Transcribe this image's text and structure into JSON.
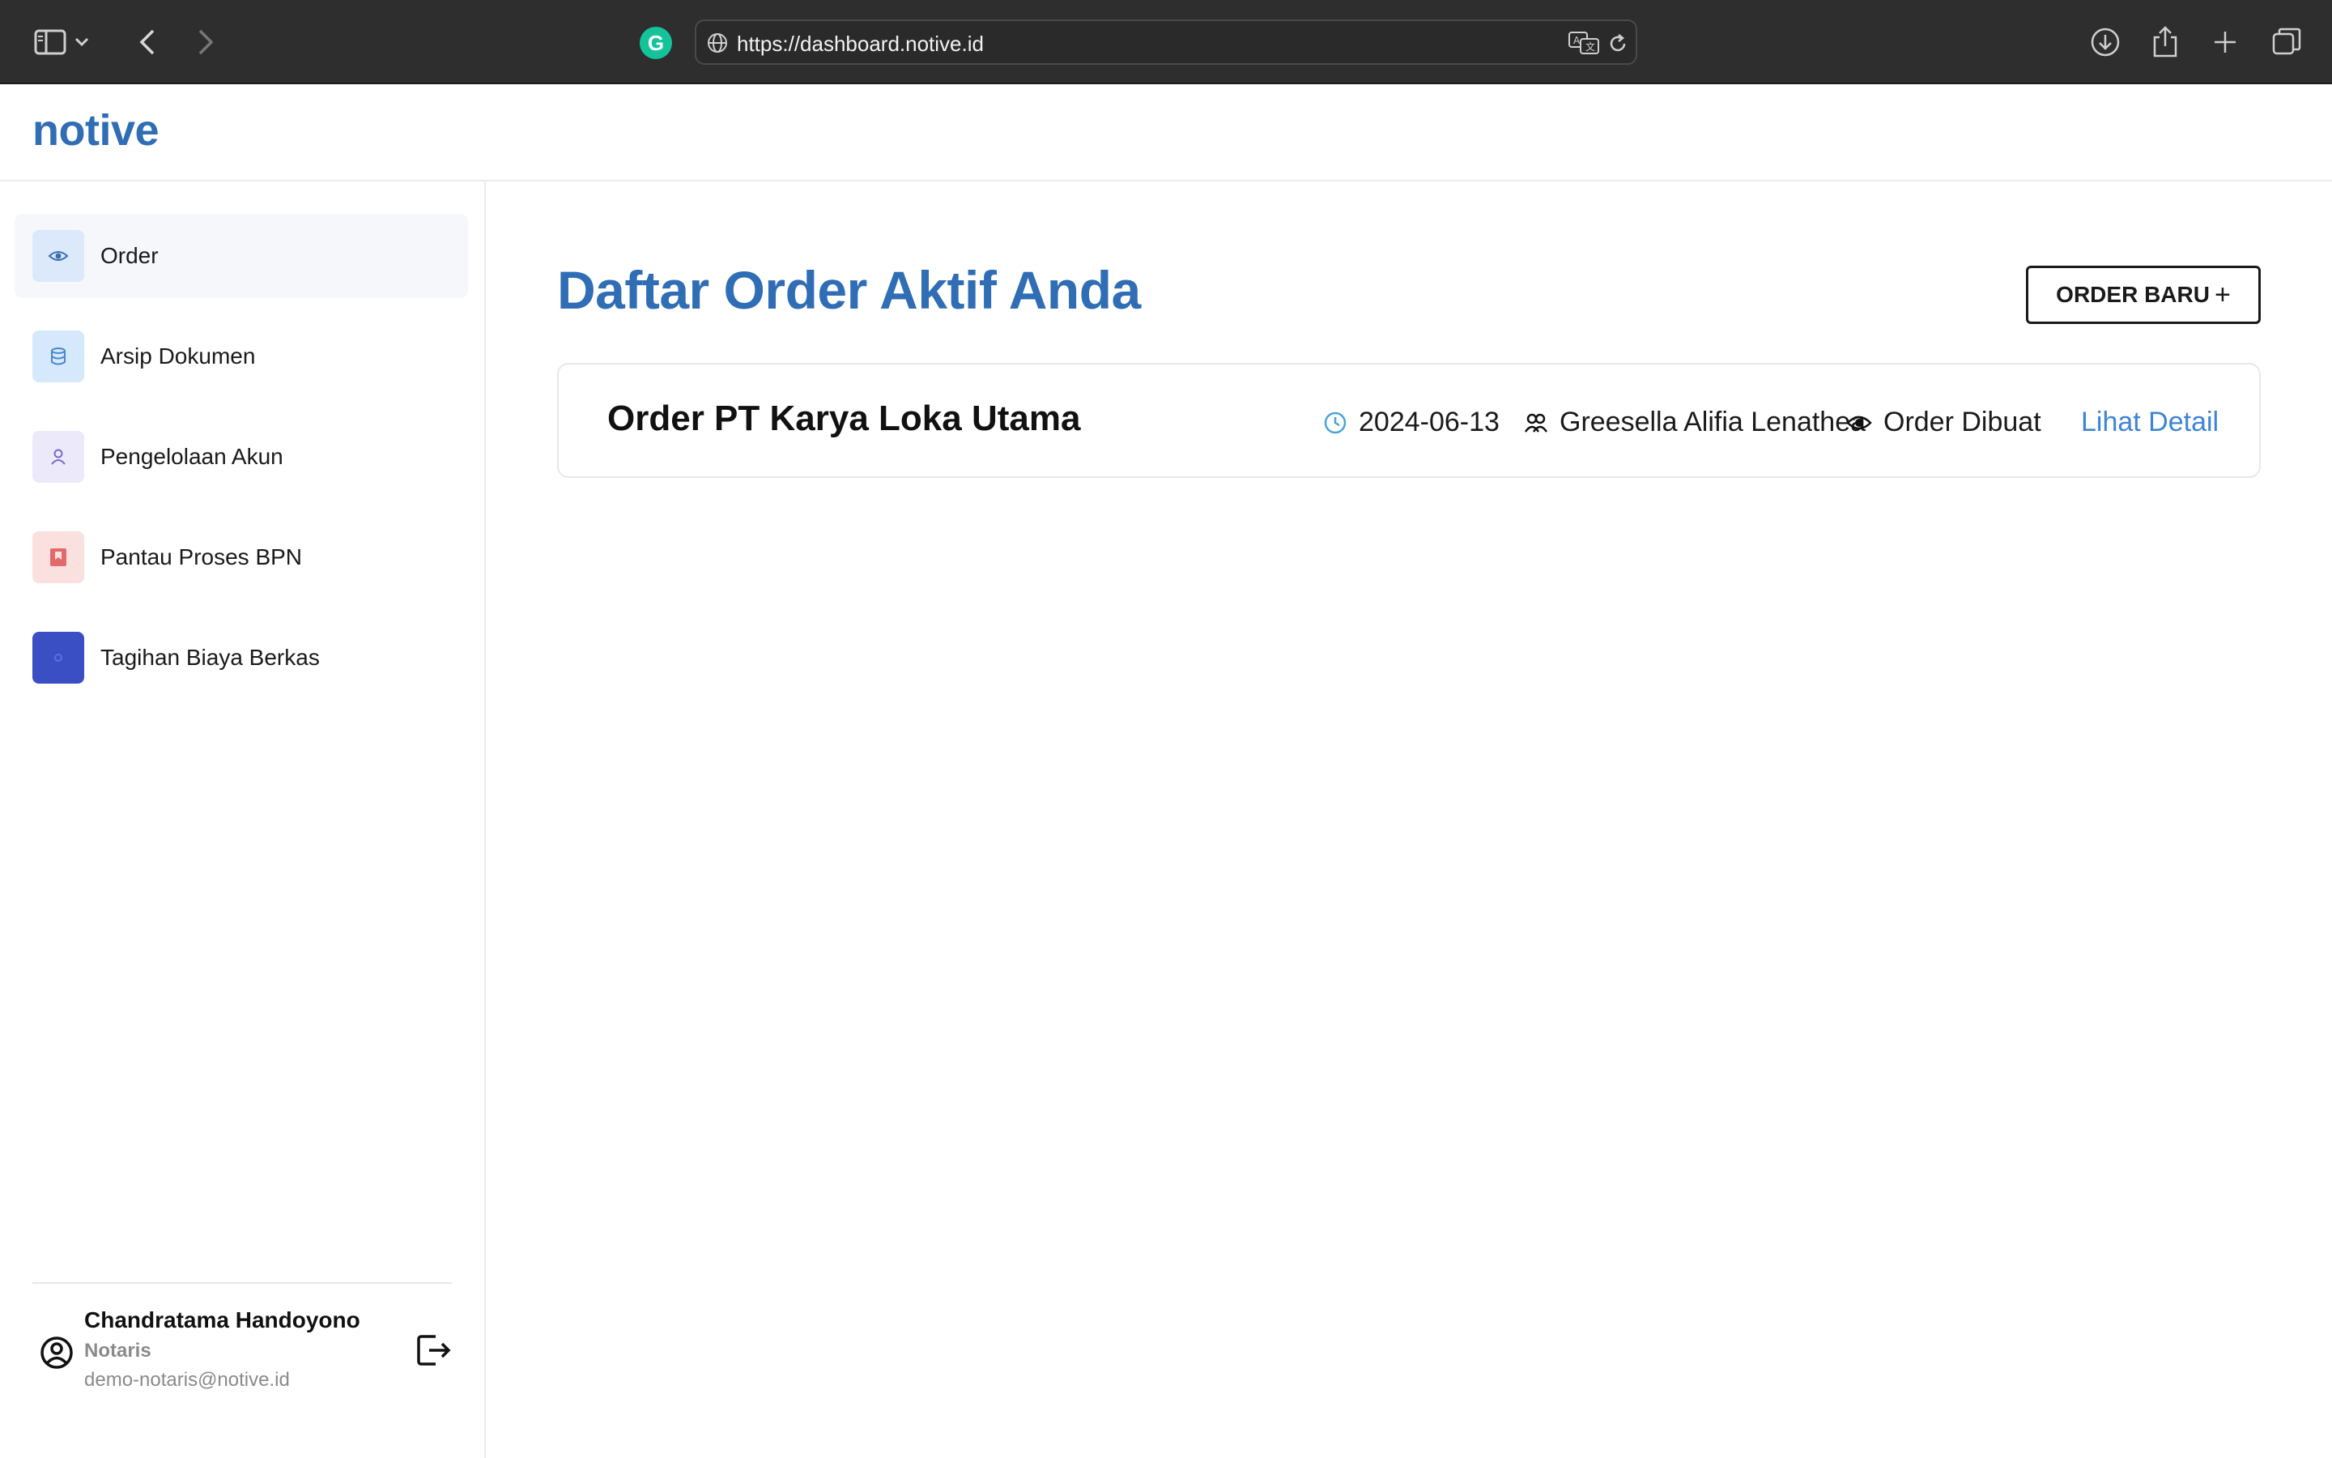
{
  "browser": {
    "url": "https://dashboard.notive.id"
  },
  "app": {
    "logo": "notive"
  },
  "sidebar": {
    "items": [
      {
        "label": "Order",
        "icon": "eye-icon",
        "icon_bg": "#dbe9fb",
        "icon_color": "#3b6fb6",
        "active": true
      },
      {
        "label": "Arsip Dokumen",
        "icon": "database-icon",
        "icon_bg": "#d6e8fb",
        "icon_color": "#4a88d1"
      },
      {
        "label": "Pengelolaan Akun",
        "icon": "user-icon",
        "icon_bg": "#ece9fb",
        "icon_color": "#7b68c8"
      },
      {
        "label": "Pantau Proses BPN",
        "icon": "bookmark-icon",
        "icon_bg": "#fbe0e0",
        "icon_color": "#e26a6a"
      },
      {
        "label": "Tagihan Biaya Berkas",
        "icon": "circle-icon",
        "icon_bg": "#3b4fc4",
        "icon_color": "#5b70e0"
      }
    ],
    "user": {
      "name": "Chandratama Handoyono",
      "role": "Notaris",
      "email": "demo-notaris@notive.id"
    }
  },
  "main": {
    "title": "Daftar Order Aktif Anda",
    "new_order_label": "ORDER BARU",
    "orders": [
      {
        "title": "Order PT Karya Loka Utama",
        "date": "2024-06-13",
        "assignee": "Greesella Alifia Lenathea",
        "status": "Order Dibuat",
        "detail_label": "Lihat Detail"
      }
    ]
  },
  "colors": {
    "brand": "#2f6db5",
    "link": "#3d84d6",
    "chrome": "#2e2e2e"
  }
}
